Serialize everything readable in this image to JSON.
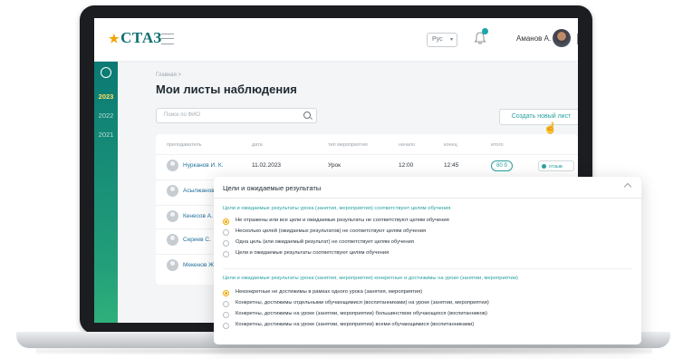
{
  "app": {
    "logo": "СТАЗ",
    "language": "Рус",
    "user_name": "Аманов А."
  },
  "sidebar": {
    "years": [
      "2023",
      "2022",
      "2021"
    ],
    "active_year": "2023"
  },
  "page": {
    "breadcrumb": "Главная >",
    "title": "Мои листы наблюдения",
    "search_placeholder": "Поиск по ФИО",
    "create_button": "Создать новый лист"
  },
  "table": {
    "headers": [
      "преподаватель",
      "дата",
      "тип мероприятия",
      "начало",
      "конец",
      "итого"
    ],
    "rows": [
      {
        "teacher": "Нурканов И. К.",
        "date": "11.02.2023",
        "type": "Урок",
        "start": "12:00",
        "end": "12:45",
        "total": "80 б",
        "action": "отзыв"
      },
      {
        "teacher": "Асылжанов"
      },
      {
        "teacher": "Кенесов А. Е"
      },
      {
        "teacher": "Сериев С."
      },
      {
        "teacher": "Мекенов Ж."
      }
    ]
  },
  "popup": {
    "title": "Цели и ожидаемые результаты",
    "sections": [
      {
        "question": "Цели и ожидаемые результаты урока (занятия, мероприятия) соответствуют целям обучения",
        "options": [
          "Не отражены или все цели и ожидаемые результаты не соответствуют целям обучения",
          "Несколько целей (ожидаемых результатов) не соответствуют целям обучения",
          "Одна цель (или ожидаемый результат) не соответствует целям обучения",
          "Цели и ожидаемые результаты соответствуют целям обучения"
        ],
        "selected": 0
      },
      {
        "question": "Цели и ожидаемые результаты урока (занятия, мероприятия) конкретные и достижимы на уроке (занятии, мероприятии)",
        "options": [
          "Неконкретные не достижимы в рамках одного урока (занятия, мероприятия)",
          "Конкретны, достижимы отдельными обучающимися (воспитанниками) на уроке (занятии, мероприятии)",
          "Конкретны, достижимы на уроке (занятии, мероприятии) большинством обучающихся (воспитанников)",
          "Конкретны, достижимы на уроке (занятии, мероприятии) всеми обучающимися (воспитанниками)"
        ],
        "selected": 0
      }
    ]
  }
}
